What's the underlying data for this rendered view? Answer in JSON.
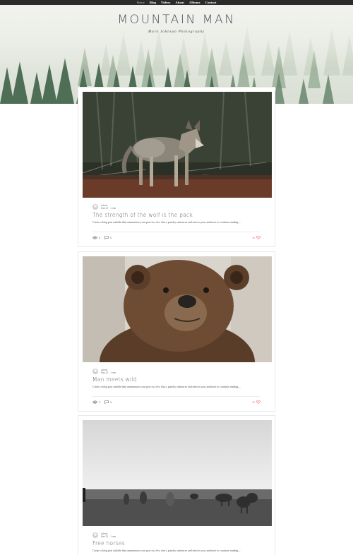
{
  "nav": {
    "items": [
      "Home",
      "Blog",
      "Videos",
      "About",
      "Albums",
      "Contact"
    ]
  },
  "header": {
    "title": "MOUNTAIN MAN",
    "subtitle": "Mark Johnson Photography"
  },
  "posts": [
    {
      "author": "Admin",
      "date": "Mar 22",
      "read_time": "1 min",
      "title": "The strength of the wolf is the pack",
      "excerpt": "Create a blog post subtitle that summarizes your post in a few short, punchy sentences and entices your audience to continue reading....",
      "views": "0",
      "comments": "0",
      "likes": "14",
      "image_subject": "wolf"
    },
    {
      "author": "Admin",
      "date": "Mar 22",
      "read_time": "1 min",
      "title": "Man meets wild",
      "excerpt": "Create a blog post subtitle that summarizes your post in a few short, punchy sentences and entices your audience to continue reading....",
      "views": "0",
      "comments": "0",
      "likes": "12",
      "image_subject": "bear"
    },
    {
      "author": "Admin",
      "date": "Mar 22",
      "read_time": "1 min",
      "title": "Free horses",
      "excerpt": "Create a blog post subtitle that summarizes your post in a few short, punchy sentences and entices your audience to continue reading....",
      "image_subject": "horses"
    }
  ],
  "icons": {
    "views": "eye-icon",
    "comments": "comment-icon",
    "likes": "heart-icon"
  },
  "colors": {
    "nav_bg": "#2b2b2b",
    "like": "#e8636a",
    "title": "#4a4f55"
  }
}
